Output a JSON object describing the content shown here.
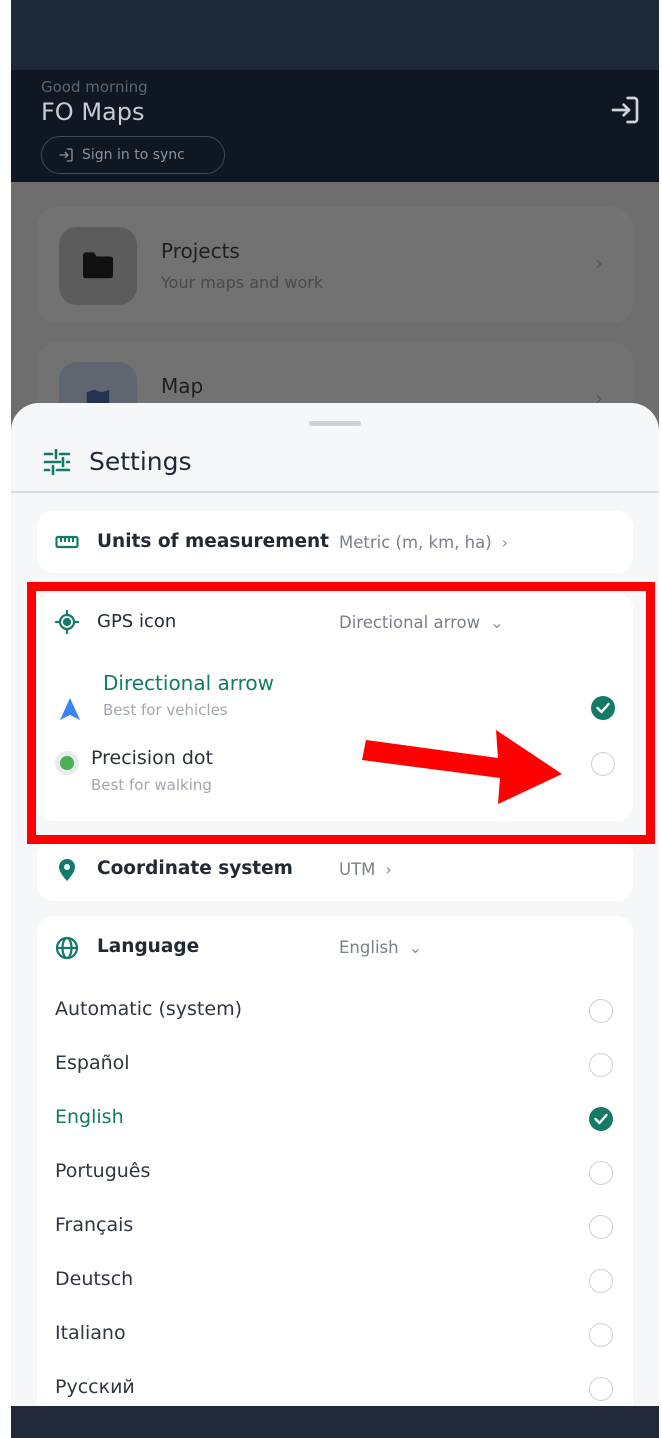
{
  "header": {
    "greeting": "Good morning",
    "app_title": "FO Maps",
    "signin_label": "Sign in to sync"
  },
  "nav_cards": [
    {
      "title": "Projects",
      "subtitle": "Your maps and work"
    },
    {
      "title": "Map"
    }
  ],
  "settings": {
    "title": "Settings",
    "units": {
      "label": "Units of measurement",
      "value": "Metric (m, km, ha)"
    },
    "gps": {
      "label": "GPS icon",
      "value": "Directional arrow",
      "options": [
        {
          "label": "Directional arrow",
          "sub": "Best for vehicles",
          "selected": true
        },
        {
          "label": "Precision dot",
          "sub": "Best for walking",
          "selected": false
        }
      ]
    },
    "coordinate": {
      "label": "Coordinate system",
      "value": "UTM"
    },
    "language": {
      "label": "Language",
      "value": "English",
      "options": [
        {
          "label": "Automatic (system)",
          "selected": false
        },
        {
          "label": "Español",
          "selected": false
        },
        {
          "label": "English",
          "selected": true
        },
        {
          "label": "Português",
          "selected": false
        },
        {
          "label": "Français",
          "selected": false
        },
        {
          "label": "Deutsch",
          "selected": false
        },
        {
          "label": "Italiano",
          "selected": false
        },
        {
          "label": "Русский",
          "selected": false
        }
      ]
    }
  },
  "colors": {
    "accent": "#137a68",
    "arrow_blue": "#3b82f6",
    "dot_green": "#4caf50",
    "annotation_red": "#ff0000"
  }
}
